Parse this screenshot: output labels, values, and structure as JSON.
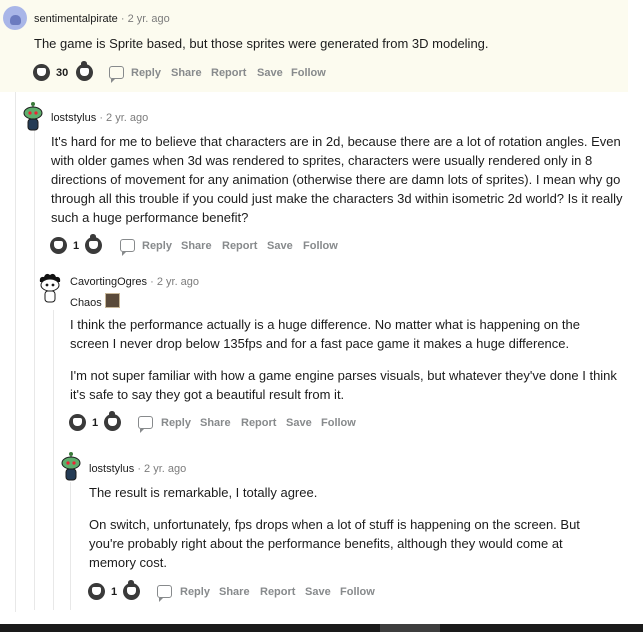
{
  "comments": [
    {
      "username": "sentimentalpirate",
      "time": "2 yr. ago",
      "text": "The game is Sprite based, but those sprites were generated from 3D modeling.",
      "votes": "30",
      "actions": [
        "Reply",
        "Share",
        "Report",
        "Save",
        "Follow"
      ]
    },
    {
      "username": "loststylus",
      "time": "2 yr. ago",
      "text": "It's hard for me to believe that characters are in 2d, because there are a lot of rotation angles. Even with older games when 3d was rendered to sprites, characters were usually rendered only in 8 directions of movement for any animation (otherwise there are damn lots of sprites). I mean why go through all this trouble if you could just make the characters 3d within isometric 2d world? Is it really such a huge performance benefit?",
      "votes": "1",
      "actions": [
        "Reply",
        "Share",
        "Report",
        "Save",
        "Follow"
      ]
    },
    {
      "username": "CavortingOgres",
      "time": "2 yr. ago",
      "flair": "Chaos",
      "paragraphs": [
        "I think the performance actually is a huge difference. No matter what is happening on the screen I never drop below 135fps and for a fast pace game it makes a huge difference.",
        "I'm not super familiar with how a game engine parses visuals, but whatever they've done I think it's safe to say they got a beautiful result from it."
      ],
      "votes": "1",
      "actions": [
        "Reply",
        "Share",
        "Report",
        "Save",
        "Follow"
      ]
    },
    {
      "username": "loststylus",
      "time": "2 yr. ago",
      "paragraphs": [
        "The result is remarkable, I totally agree.",
        "On switch, unfortunately, fps drops when a lot of stuff is happening on the screen. But you're probably right about the performance benefits, although they would come at memory cost."
      ],
      "votes": "1",
      "actions": [
        "Reply",
        "Share",
        "Report",
        "Save",
        "Follow"
      ]
    }
  ],
  "separator": "·",
  "icons": {
    "upvote": "upvote-icon",
    "downvote": "downvote-icon",
    "reply": "reply-bubble-icon"
  },
  "colors": {
    "highlight_bg": "#fcfbef",
    "meta": "#7c7c7c",
    "action": "#878a8c"
  }
}
